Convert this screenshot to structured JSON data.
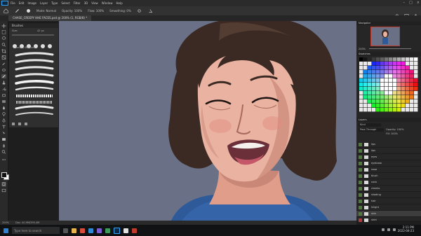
{
  "menu": {
    "items": [
      "File",
      "Edit",
      "Image",
      "Layer",
      "Type",
      "Select",
      "Filter",
      "3D",
      "View",
      "Window",
      "Help"
    ]
  },
  "options_bar": {
    "mode_label": "Mode:",
    "mode_value": "Normal",
    "opacity_label": "Opacity:",
    "opacity_value": "100%",
    "flow_label": "Flow:",
    "flow_value": "100%",
    "smoothing_label": "Smoothing:",
    "smoothing_value": "0%"
  },
  "document_tab": {
    "title": "CHASE_CREEPY HHE FACES.psd @ 200% (1, RGB/8) *"
  },
  "brushes_panel": {
    "title": "Brushes",
    "size_value": "42 px",
    "section_label": "General Brushes"
  },
  "navigator": {
    "title": "Navigator",
    "zoom": "200%"
  },
  "swatches": {
    "title": "Swatches"
  },
  "layers_panel": {
    "title": "Layers",
    "search_label": "Kind",
    "blend_mode": "Pass Through",
    "opacity_label": "Opacity:",
    "opacity_value": "100%",
    "fill_label": "Fill:",
    "fill_value": "100%",
    "layers": [
      "lips",
      "lips",
      "eyes",
      "eyebrow",
      "nose",
      "blush",
      "neck",
      "cheeks",
      "shading",
      "hair",
      "hilight",
      "skin",
      "shirt",
      "BG"
    ]
  },
  "status_bar": {
    "zoom": "200%",
    "doc_info": "Doc: 40.9M/395.4M"
  },
  "taskbar": {
    "search_placeholder": "Type here to search",
    "time": "2:11 PM",
    "date": "2022-04-23"
  },
  "colors": {
    "canvas_bg": "#6a7187",
    "hair": "#3b2a24",
    "skin": "#eab2a1",
    "shirt": "#2e5a9a",
    "accent": "#31a8ff"
  }
}
